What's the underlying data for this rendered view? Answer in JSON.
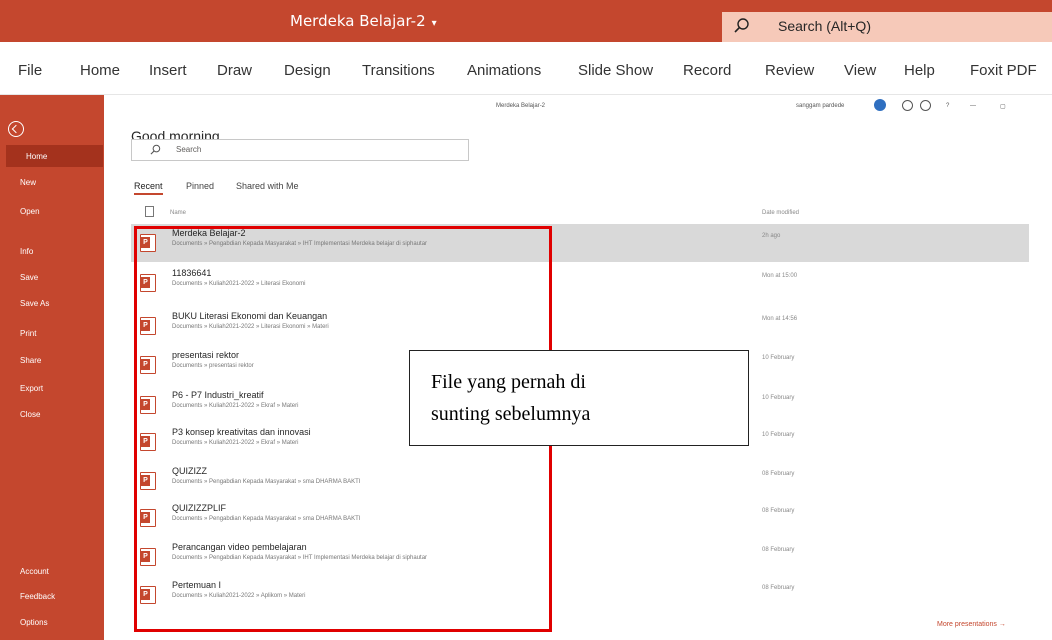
{
  "window": {
    "title": "Merdeka Belajar-2",
    "title_caret": "▾",
    "search_label": "Search (Alt+Q)"
  },
  "ribbon_tabs": [
    "File",
    "Home",
    "Insert",
    "Draw",
    "Design",
    "Transitions",
    "Animations",
    "Slide Show",
    "Record",
    "Review",
    "View",
    "Help",
    "Foxit PDF"
  ],
  "top_right": {
    "doc_title": "Merdeka Belajar-2",
    "user": "sanggam pardede",
    "help": "?",
    "minimize": "—",
    "restore": "▢"
  },
  "sidebar": {
    "top": [
      "Home",
      "New",
      "Open"
    ],
    "middle": [
      "Info",
      "Save",
      "Save As",
      "Print",
      "Share",
      "Export",
      "Close"
    ],
    "bottom": [
      "Account",
      "Feedback",
      "Options"
    ]
  },
  "main": {
    "greeting": "Good morning",
    "search_placeholder": "Search",
    "tabs": [
      "Recent",
      "Pinned",
      "Shared with Me"
    ],
    "headers": {
      "name": "Name",
      "date": "Date modified"
    },
    "files": [
      {
        "name": "Merdeka Belajar-2",
        "path": "Documents » Pengabdian Kepada Masyarakat » IHT Implementasi Merdeka belajar di siphautar",
        "date": "2h ago"
      },
      {
        "name": "11836641",
        "path": "Documents » Kuliah2021-2022 » Literasi Ekonomi",
        "date": "Mon at 15:00"
      },
      {
        "name": "BUKU Literasi Ekonomi dan Keuangan",
        "path": "Documents » Kuliah2021-2022 » Literasi Ekonomi » Materi",
        "date": "Mon at 14:56"
      },
      {
        "name": "presentasi rektor",
        "path": "Documents » presentasi rektor",
        "date": "10 February"
      },
      {
        "name": "P6 - P7 Industri_kreatif",
        "path": "Documents » Kuliah2021-2022 » Ekraf » Materi",
        "date": "10 February"
      },
      {
        "name": "P3 konsep kreativitas dan innovasi",
        "path": "Documents » Kuliah2021-2022 » Ekraf » Materi",
        "date": "10 February"
      },
      {
        "name": "QUIZIZZ",
        "path": "Documents » Pengabdian Kepada Masyarakat » sma DHARMA BAKTI",
        "date": "08 February"
      },
      {
        "name": "QUIZIZZPLIF",
        "path": "Documents » Pengabdian Kepada Masyarakat » sma DHARMA BAKTI",
        "date": "08 February"
      },
      {
        "name": "Perancangan video pembelajaran",
        "path": "Documents » Pengabdian Kepada Masyarakat » IHT Implementasi Merdeka belajar di siphautar",
        "date": "08 February"
      },
      {
        "name": "Pertemuan I",
        "path": "Documents » Kuliah2021-2022 » Aplikom » Materi",
        "date": "08 February"
      }
    ],
    "more_link": "More presentations →"
  },
  "annotation": {
    "line1": "File yang pernah di",
    "line2": "sunting sebelumnya"
  },
  "colors": {
    "accent": "#c4472e",
    "highlight": "#e00000"
  }
}
